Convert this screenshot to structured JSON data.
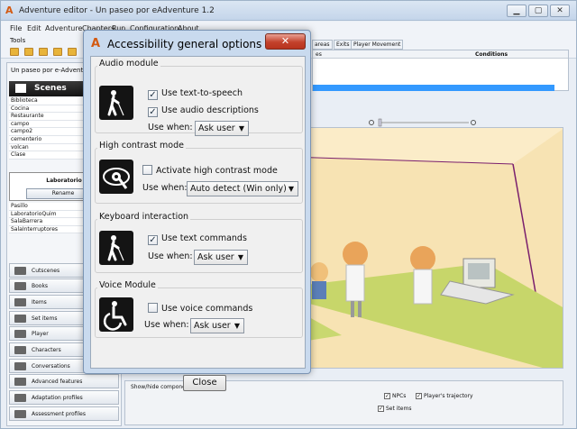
{
  "window": {
    "title": "Adventure editor - Un paseo por eAdventure 1.2"
  },
  "menu": [
    "File",
    "Edit",
    "Adventure",
    "Chapters",
    "Run",
    "Configuration",
    "About"
  ],
  "tools_label": "Tools",
  "adventure_name": "Un paseo por e-Adventure",
  "scenes": {
    "header": "Scenes",
    "list_top": [
      "Biblioteca",
      "Cocina",
      "Restaurante",
      "campo",
      "campo2",
      "cementerio",
      "volcan",
      "Clase"
    ],
    "selected": "Laboratorio",
    "rename_label": "Rename",
    "list_bottom": [
      "Pasillo",
      "LaboratorioQuim",
      "SalaBarrera",
      "SalaInterruptores"
    ]
  },
  "categories": [
    "Cutscenes",
    "Books",
    "Items",
    "Set items",
    "Player",
    "Characters",
    "Conversations",
    "Advanced features",
    "Adaptation profiles",
    "Assessment profiles"
  ],
  "tabs": [
    "areas",
    "Exits",
    "Player Movement"
  ],
  "grid": {
    "col_conditions": "Conditions",
    "col_left": "es"
  },
  "bottom_panel": {
    "title": "Show/hide components",
    "npcs": "NPCs",
    "trajectory": "Player's trajectory",
    "set_items": "Set items"
  },
  "dialog": {
    "title": "Accessibility general options",
    "close_x": "✕",
    "audio": {
      "title": "Audio module",
      "tts_label": "Use text-to-speech",
      "tts_checked": true,
      "desc_label": "Use audio descriptions",
      "desc_checked": true,
      "use_when_label": "Use when:",
      "use_when_value": "Ask user"
    },
    "contrast": {
      "title": "High contrast mode",
      "activate_label": "Activate high contrast mode",
      "activate_checked": false,
      "use_when_label": "Use when:",
      "use_when_value": "Auto detect (Win only)"
    },
    "keyboard": {
      "title": "Keyboard interaction",
      "text_cmd_label": "Use text commands",
      "text_cmd_checked": true,
      "use_when_label": "Use when:",
      "use_when_value": "Ask user"
    },
    "voice": {
      "title": "Voice Module",
      "voice_cmd_label": "Use voice commands",
      "voice_cmd_checked": false,
      "use_when_label": "Use when:",
      "use_when_value": "Ask user"
    },
    "close_button": "Close"
  },
  "colors": {
    "accent": "#d35a12",
    "selection": "#3399ff",
    "close_red": "#c3412b"
  }
}
